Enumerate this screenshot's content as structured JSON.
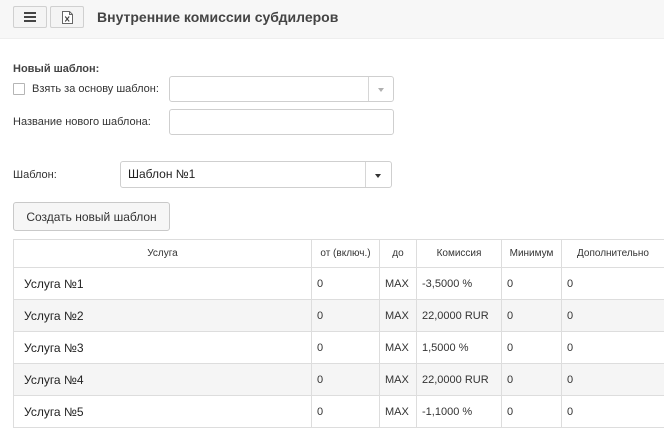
{
  "header": {
    "title": "Внутренние комиссии субдилеров",
    "menu_icon": "hamburger-icon",
    "export_icon": "excel-export-icon"
  },
  "new_template": {
    "section_label": "Новый шаблон:",
    "base_checkbox_label": "Взять за основу шаблон:",
    "base_checkbox_checked": false,
    "base_select_value": "",
    "name_label": "Название нового шаблона:",
    "name_value": ""
  },
  "template": {
    "label": "Шаблон:",
    "selected": "Шаблон №1"
  },
  "create_button": "Создать новый шаблон",
  "table": {
    "columns": [
      "Услуга",
      "от (включ.)",
      "до",
      "Комиссия",
      "Минимум",
      "Дополнительно"
    ],
    "rows": [
      [
        "Услуга №1",
        "0",
        "MAX",
        "-3,5000 %",
        "0",
        "0"
      ],
      [
        "Услуга №2",
        "0",
        "MAX",
        "22,0000 RUR",
        "0",
        "0"
      ],
      [
        "Услуга №3",
        "0",
        "MAX",
        "1,5000 %",
        "0",
        "0"
      ],
      [
        "Услуга №4",
        "0",
        "MAX",
        "22,0000 RUR",
        "0",
        "0"
      ],
      [
        "Услуга №5",
        "0",
        "MAX",
        "-1,1000 %",
        "0",
        "0"
      ]
    ]
  }
}
